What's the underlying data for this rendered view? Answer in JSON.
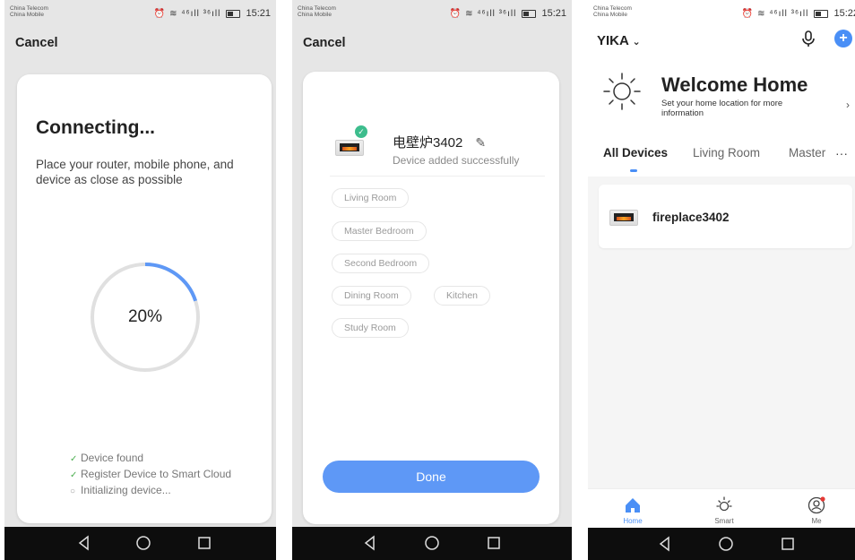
{
  "status_bar": {
    "carrier1": "China Telecom",
    "carrier2": "China Mobile",
    "icons": "⏰ ≋ ⁴⁶ıll ³⁶ıll",
    "screen1_time": "15:21",
    "screen2_time": "15:21",
    "screen3_time": "15:22"
  },
  "screen1": {
    "cancel_label": "Cancel",
    "title": "Connecting...",
    "subtitle": "Place your router, mobile phone, and device as close as possible",
    "progress_text": "20%",
    "progress_value": 0.2,
    "steps": [
      {
        "label": "Device found",
        "state": "done"
      },
      {
        "label": "Register Device to Smart Cloud",
        "state": "done"
      },
      {
        "label": "Initializing device...",
        "state": "pending"
      }
    ]
  },
  "screen2": {
    "cancel_label": "Cancel",
    "device_name": "电壁炉3402",
    "device_status": "Device added successfully",
    "rooms": [
      "Living Room",
      "Master Bedroom",
      "Second Bedroom",
      "Dining Room",
      "Kitchen",
      "Study Room"
    ],
    "done_label": "Done"
  },
  "screen3": {
    "home_name": "YIKA",
    "welcome_title": "Welcome Home",
    "welcome_subtitle": "Set your home location for more information",
    "tabs": [
      "All Devices",
      "Living Room",
      "Master"
    ],
    "more_tabs": "···",
    "device_name": "fireplace3402",
    "bottom_tabs": [
      "Home",
      "Smart",
      "Me"
    ]
  },
  "colors": {
    "accent": "#5e98f6",
    "tab_accent": "#4a8ff6",
    "success": "#3dbd8d",
    "progress_track": "#e0e0e0"
  }
}
